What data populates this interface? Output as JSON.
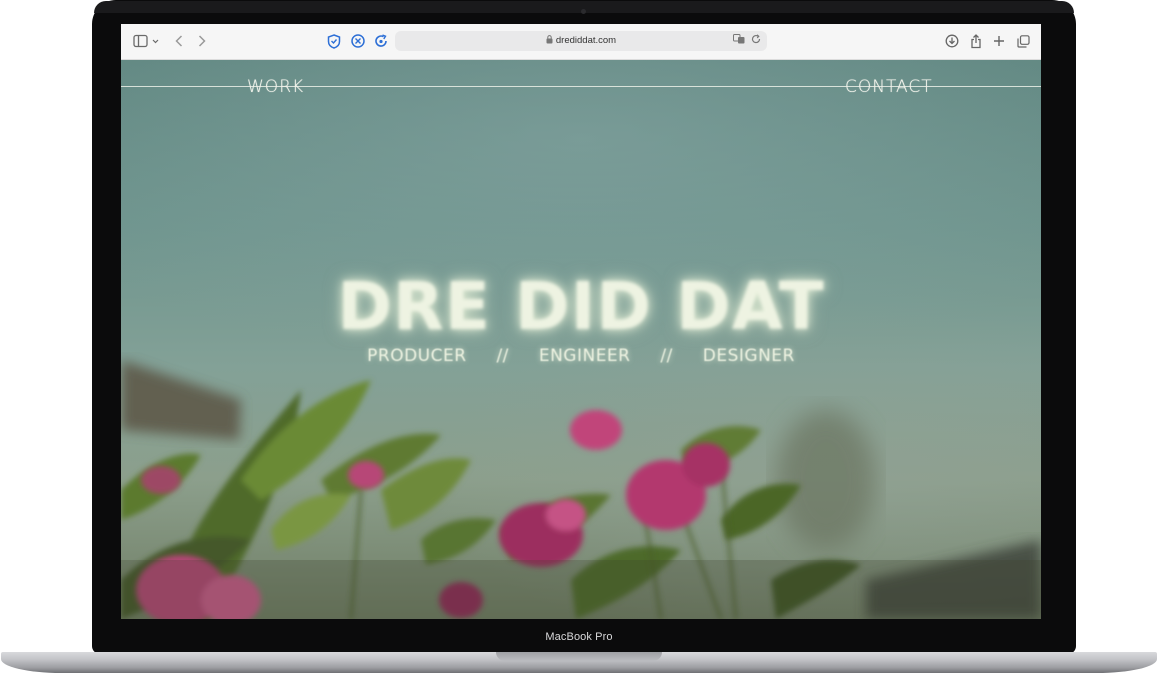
{
  "browser": {
    "url": "drediddat.com"
  },
  "nav": {
    "work": "WORK",
    "contact": "CONTACT"
  },
  "hero": {
    "title": "DRE DID DAT",
    "roles": [
      "PRODUCER",
      "//",
      "ENGINEER",
      "//",
      "DESIGNER"
    ]
  },
  "device": {
    "model_label": "MacBook Pro"
  },
  "colors": {
    "sky": "#6e948d",
    "text": "#eef3e2",
    "flower": "#b23a6e",
    "leaf": "#56692e"
  }
}
